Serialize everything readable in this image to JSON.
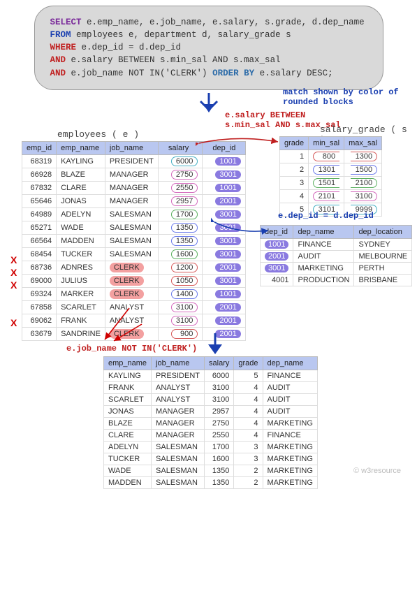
{
  "sql": {
    "line1_kw": "SELECT",
    "line1_cols": " e.emp_name, e.job_name, e.salary, s.grade, d.dep_name",
    "line2_kw": "FROM",
    "line2_txt": " employees e, department d, salary_grade s",
    "line3_kw": "WHERE",
    "line3_txt": " e.dep_id = d.dep_id",
    "line4_kw": "AND",
    "line4_txt": " e.salary BETWEEN s.min_sal AND s.max_sal",
    "line5_kw": "AND",
    "line5_txt": " e.job_name NOT IN('CLERK') ",
    "line5_ord": "ORDER BY",
    "line5_txt2": " e.salary DESC;"
  },
  "annot": {
    "match_ln1": "match shown by color of",
    "match_ln2": "rounded blocks",
    "between_ln1": "e.salary BETWEEN",
    "between_ln2": "s.min_sal AND s.max_sal",
    "notin": "e.job_name NOT IN('CLERK')",
    "depjoin": "e.dep_id = d.dep_id"
  },
  "emp": {
    "title": "employees ( e )",
    "headers": [
      "emp_id",
      "emp_name",
      "job_name",
      "salary",
      "dep_id"
    ],
    "rows": [
      {
        "id": 68319,
        "name": "KAYLING",
        "job": "PRESIDENT",
        "sal": 6000,
        "sal_cls": "rnd-teal",
        "dep": 1001,
        "clerk": false
      },
      {
        "id": 66928,
        "name": "BLAZE",
        "job": "MANAGER",
        "sal": 2750,
        "sal_cls": "rnd-mag",
        "dep": 3001,
        "clerk": false
      },
      {
        "id": 67832,
        "name": "CLARE",
        "job": "MANAGER",
        "sal": 2550,
        "sal_cls": "rnd-mag",
        "dep": 1001,
        "clerk": false
      },
      {
        "id": 65646,
        "name": "JONAS",
        "job": "MANAGER",
        "sal": 2957,
        "sal_cls": "rnd-mag",
        "dep": 2001,
        "clerk": false
      },
      {
        "id": 64989,
        "name": "ADELYN",
        "job": "SALESMAN",
        "sal": 1700,
        "sal_cls": "rnd-grn",
        "dep": 3001,
        "clerk": false
      },
      {
        "id": 65271,
        "name": "WADE",
        "job": "SALESMAN",
        "sal": 1350,
        "sal_cls": "rnd-blue",
        "dep": 3001,
        "clerk": false
      },
      {
        "id": 66564,
        "name": "MADDEN",
        "job": "SALESMAN",
        "sal": 1350,
        "sal_cls": "rnd-blue",
        "dep": 3001,
        "clerk": false
      },
      {
        "id": 68454,
        "name": "TUCKER",
        "job": "SALESMAN",
        "sal": 1600,
        "sal_cls": "rnd-grn",
        "dep": 3001,
        "clerk": false
      },
      {
        "id": 68736,
        "name": "ADNRES",
        "job": "CLERK",
        "sal": 1200,
        "sal_cls": "rnd-red",
        "dep": 2001,
        "clerk": true
      },
      {
        "id": 69000,
        "name": "JULIUS",
        "job": "CLERK",
        "sal": 1050,
        "sal_cls": "rnd-red",
        "dep": 3001,
        "clerk": true
      },
      {
        "id": 69324,
        "name": "MARKER",
        "job": "CLERK",
        "sal": 1400,
        "sal_cls": "rnd-blue",
        "dep": 1001,
        "clerk": true
      },
      {
        "id": 67858,
        "name": "SCARLET",
        "job": "ANALYST",
        "sal": 3100,
        "sal_cls": "rnd-mag",
        "dep": 2001,
        "clerk": false
      },
      {
        "id": 69062,
        "name": "FRANK",
        "job": "ANALYST",
        "sal": 3100,
        "sal_cls": "rnd-mag",
        "dep": 2001,
        "clerk": false
      },
      {
        "id": 63679,
        "name": "SANDRINE",
        "job": "CLERK",
        "sal": 900,
        "sal_cls": "rnd-red",
        "dep": 2001,
        "clerk": true
      }
    ]
  },
  "grade": {
    "title": "salary_grade ( s )",
    "headers": [
      "grade",
      "min_sal",
      "max_sal"
    ],
    "rows": [
      {
        "g": 1,
        "min": 800,
        "max": 1300,
        "cls": "rnd-red"
      },
      {
        "g": 2,
        "min": 1301,
        "max": 1500,
        "cls": "rnd-blue"
      },
      {
        "g": 3,
        "min": 1501,
        "max": 2100,
        "cls": "rnd-grn"
      },
      {
        "g": 4,
        "min": 2101,
        "max": 3100,
        "cls": "rnd-mag"
      },
      {
        "g": 5,
        "min": 3101,
        "max": 9999,
        "cls": "rnd-teal"
      }
    ]
  },
  "dep": {
    "headers": [
      "dep_id",
      "dep_name",
      "dep_location"
    ],
    "rows": [
      {
        "id": 1001,
        "name": "FINANCE",
        "loc": "SYDNEY",
        "hl": true
      },
      {
        "id": 2001,
        "name": "AUDIT",
        "loc": "MELBOURNE",
        "hl": true
      },
      {
        "id": 3001,
        "name": "MARKETING",
        "loc": "PERTH",
        "hl": true
      },
      {
        "id": 4001,
        "name": "PRODUCTION",
        "loc": "BRISBANE",
        "hl": false
      }
    ]
  },
  "result": {
    "headers": [
      "emp_name",
      "job_name",
      "salary",
      "grade",
      "dep_name"
    ],
    "rows": [
      [
        "KAYLING",
        "PRESIDENT",
        6000,
        5,
        "FINANCE"
      ],
      [
        "FRANK",
        "ANALYST",
        3100,
        4,
        "AUDIT"
      ],
      [
        "SCARLET",
        "ANALYST",
        3100,
        4,
        "AUDIT"
      ],
      [
        "JONAS",
        "MANAGER",
        2957,
        4,
        "AUDIT"
      ],
      [
        "BLAZE",
        "MANAGER",
        2750,
        4,
        "MARKETING"
      ],
      [
        "CLARE",
        "MANAGER",
        2550,
        4,
        "FINANCE"
      ],
      [
        "ADELYN",
        "SALESMAN",
        1700,
        3,
        "MARKETING"
      ],
      [
        "TUCKER",
        "SALESMAN",
        1600,
        3,
        "MARKETING"
      ],
      [
        "WADE",
        "SALESMAN",
        1350,
        2,
        "MARKETING"
      ],
      [
        "MADDEN",
        "SALESMAN",
        1350,
        2,
        "MARKETING"
      ]
    ]
  },
  "watermark": "© w3resource"
}
